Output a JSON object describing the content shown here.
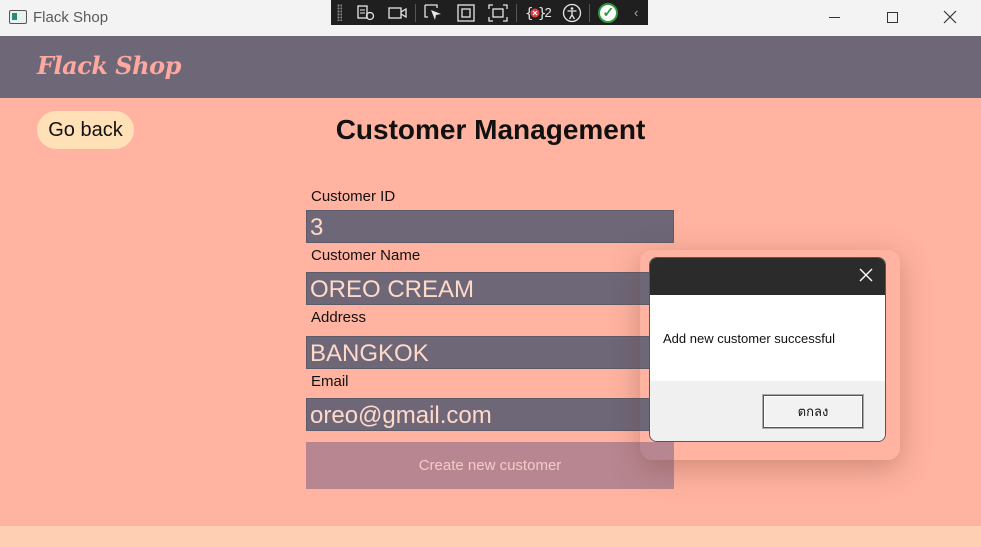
{
  "window": {
    "title": "Flack Shop"
  },
  "devtools": {
    "error_count": "2"
  },
  "header": {
    "brand": "Flack Shop"
  },
  "nav": {
    "go_back_label": "Go back"
  },
  "page": {
    "title": "Customer Management"
  },
  "form": {
    "customer_id": {
      "label": "Customer ID",
      "value": "3"
    },
    "customer_name": {
      "label": "Customer Name",
      "value": "OREO CREAM"
    },
    "address": {
      "label": "Address",
      "value": "BANGKOK"
    },
    "email": {
      "label": "Email",
      "value": "oreo@gmail.com"
    },
    "submit_label": "Create new customer"
  },
  "dialog": {
    "message": "Add new customer successful",
    "ok_label": "ตกลง"
  },
  "colors": {
    "background": "#ffb3a0",
    "header": "#6d6777",
    "input": "#6d6777",
    "go_back": "#ffe0b7",
    "button": "#b88690"
  }
}
